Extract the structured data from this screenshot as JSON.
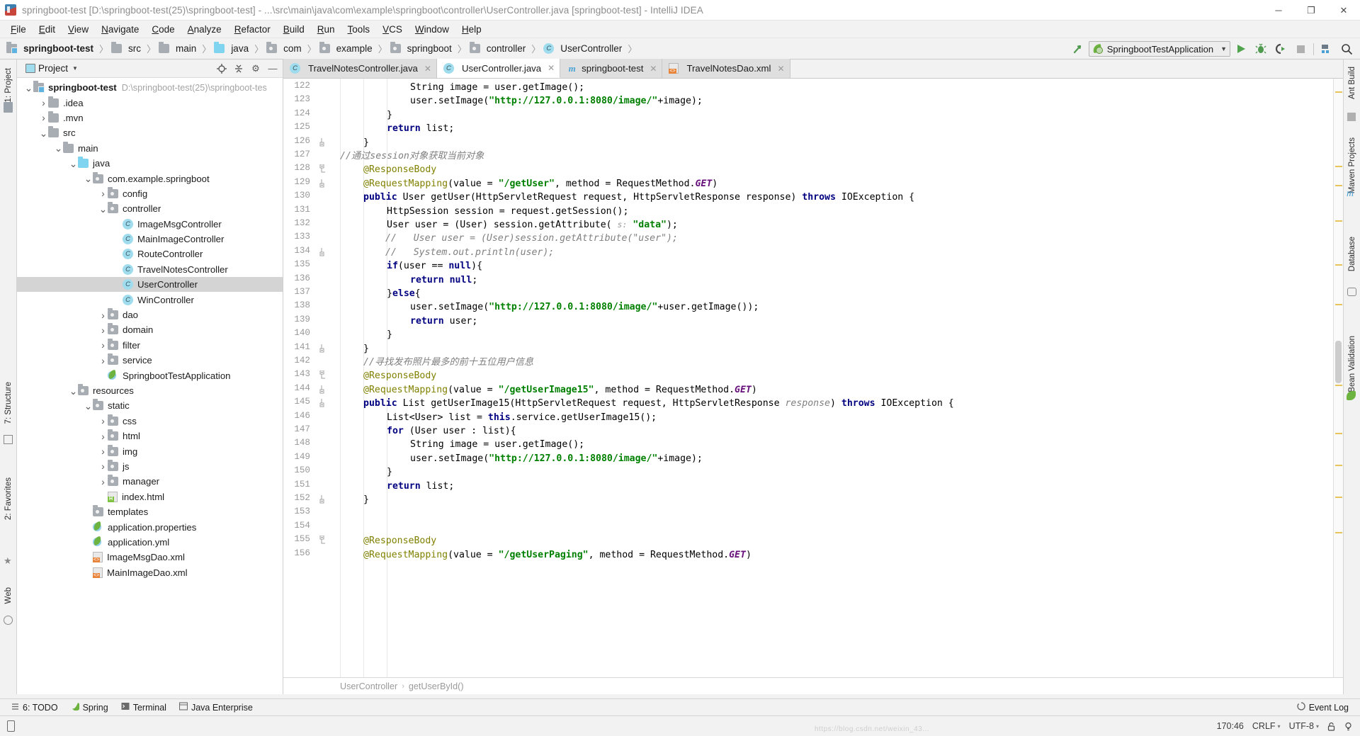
{
  "window": {
    "title": "springboot-test [D:\\springboot-test(25)\\springboot-test] - ...\\src\\main\\java\\com\\example\\springboot\\controller\\UserController.java [springboot-test] - IntelliJ IDEA",
    "minimize": "─",
    "maximize": "❐",
    "close": "✕"
  },
  "menu": [
    "File",
    "Edit",
    "View",
    "Navigate",
    "Code",
    "Analyze",
    "Refactor",
    "Build",
    "Run",
    "Tools",
    "VCS",
    "Window",
    "Help"
  ],
  "breadcrumbs": [
    {
      "label": "springboot-test",
      "icon": "module-icon"
    },
    {
      "label": "src",
      "icon": "folder-icon"
    },
    {
      "label": "main",
      "icon": "folder-icon"
    },
    {
      "label": "java",
      "icon": "source-folder-icon"
    },
    {
      "label": "com",
      "icon": "package-icon"
    },
    {
      "label": "example",
      "icon": "package-icon"
    },
    {
      "label": "springboot",
      "icon": "package-icon"
    },
    {
      "label": "controller",
      "icon": "package-icon"
    },
    {
      "label": "UserController",
      "icon": "class-icon"
    }
  ],
  "toolbar": {
    "hammer_icon": "build-icon",
    "run_config": "SpringbootTestApplication",
    "run_icon": "run-icon",
    "debug_icon": "debug-icon",
    "run_coverage_icon": "run-with-coverage-icon",
    "stop_icon": "stop-icon",
    "project_structure_icon": "project-structure-icon",
    "search_icon": "search-everywhere-icon"
  },
  "project_panel": {
    "title": "Project",
    "locate_icon": "locate-file-icon",
    "collapse_icon": "collapse-all-icon",
    "settings_icon": "gear-icon",
    "hide_icon": "hide-icon",
    "tree": [
      {
        "label": "springboot-test",
        "path": "D:\\springboot-test(25)\\springboot-tes",
        "depth": 0,
        "arrow": "down",
        "icon": "module-icon",
        "bold": true
      },
      {
        "label": ".idea",
        "depth": 1,
        "arrow": "right",
        "icon": "folder-icon"
      },
      {
        "label": ".mvn",
        "depth": 1,
        "arrow": "right",
        "icon": "folder-icon"
      },
      {
        "label": "src",
        "depth": 1,
        "arrow": "down",
        "icon": "folder-icon"
      },
      {
        "label": "main",
        "depth": 2,
        "arrow": "down",
        "icon": "folder-icon"
      },
      {
        "label": "java",
        "depth": 3,
        "arrow": "down",
        "icon": "source-folder-icon"
      },
      {
        "label": "com.example.springboot",
        "depth": 4,
        "arrow": "down",
        "icon": "package-icon"
      },
      {
        "label": "config",
        "depth": 5,
        "arrow": "right",
        "icon": "package-icon"
      },
      {
        "label": "controller",
        "depth": 5,
        "arrow": "down",
        "icon": "package-icon"
      },
      {
        "label": "ImageMsgController",
        "depth": 6,
        "arrow": "none",
        "icon": "class-icon"
      },
      {
        "label": "MainImageController",
        "depth": 6,
        "arrow": "none",
        "icon": "class-icon"
      },
      {
        "label": "RouteController",
        "depth": 6,
        "arrow": "none",
        "icon": "class-icon"
      },
      {
        "label": "TravelNotesController",
        "depth": 6,
        "arrow": "none",
        "icon": "class-icon"
      },
      {
        "label": "UserController",
        "depth": 6,
        "arrow": "none",
        "icon": "class-icon",
        "selected": true
      },
      {
        "label": "WinController",
        "depth": 6,
        "arrow": "none",
        "icon": "class-icon"
      },
      {
        "label": "dao",
        "depth": 5,
        "arrow": "right",
        "icon": "package-icon"
      },
      {
        "label": "domain",
        "depth": 5,
        "arrow": "right",
        "icon": "package-icon"
      },
      {
        "label": "filter",
        "depth": 5,
        "arrow": "right",
        "icon": "package-icon"
      },
      {
        "label": "service",
        "depth": 5,
        "arrow": "right",
        "icon": "package-icon"
      },
      {
        "label": "SpringbootTestApplication",
        "depth": 5,
        "arrow": "none",
        "icon": "spring-class-icon"
      },
      {
        "label": "resources",
        "depth": 3,
        "arrow": "down",
        "icon": "resource-folder-icon"
      },
      {
        "label": "static",
        "depth": 4,
        "arrow": "down",
        "icon": "package-icon"
      },
      {
        "label": "css",
        "depth": 5,
        "arrow": "right",
        "icon": "package-icon"
      },
      {
        "label": "html",
        "depth": 5,
        "arrow": "right",
        "icon": "package-icon"
      },
      {
        "label": "img",
        "depth": 5,
        "arrow": "right",
        "icon": "package-icon"
      },
      {
        "label": "js",
        "depth": 5,
        "arrow": "right",
        "icon": "package-icon"
      },
      {
        "label": "manager",
        "depth": 5,
        "arrow": "right",
        "icon": "package-icon"
      },
      {
        "label": "index.html",
        "depth": 5,
        "arrow": "none",
        "icon": "html-file-icon"
      },
      {
        "label": "templates",
        "depth": 4,
        "arrow": "none",
        "icon": "package-icon"
      },
      {
        "label": "application.properties",
        "depth": 4,
        "arrow": "none",
        "icon": "spring-file-icon"
      },
      {
        "label": "application.yml",
        "depth": 4,
        "arrow": "none",
        "icon": "spring-file-icon"
      },
      {
        "label": "ImageMsgDao.xml",
        "depth": 4,
        "arrow": "none",
        "icon": "xml-file-icon"
      },
      {
        "label": "MainImageDao.xml",
        "depth": 4,
        "arrow": "none",
        "icon": "xml-file-icon"
      }
    ]
  },
  "left_rail": [
    {
      "label": "1: Project",
      "icon": "project-tool-icon"
    },
    {
      "label": "7: Structure",
      "icon": "structure-tool-icon"
    },
    {
      "label": "2: Favorites",
      "icon": "favorites-tool-icon"
    },
    {
      "label": "Web",
      "icon": "web-tool-icon"
    }
  ],
  "right_rail": [
    {
      "label": "Ant Build",
      "icon": "ant-icon"
    },
    {
      "label": "Maven Projects",
      "icon": "maven-icon"
    },
    {
      "label": "Database",
      "icon": "database-icon"
    },
    {
      "label": "Bean Validation",
      "icon": "bean-validation-icon"
    }
  ],
  "tabs": [
    {
      "label": "TravelNotesController.java",
      "icon": "class-icon",
      "active": false,
      "close": "✕"
    },
    {
      "label": "UserController.java",
      "icon": "class-icon",
      "active": true,
      "close": "✕"
    },
    {
      "label": "springboot-test",
      "icon": "maven-icon",
      "active": false,
      "close": "✕"
    },
    {
      "label": "TravelNotesDao.xml",
      "icon": "xml-file-icon",
      "active": false,
      "close": "✕"
    }
  ],
  "editor": {
    "first_line": 122,
    "lines": [
      {
        "n": 122,
        "indent": 3,
        "html": "String image = user.getImage();"
      },
      {
        "n": 123,
        "indent": 3,
        "html": "user.setImage(<span class=\"s\">\"http://127.0.0.1:8080/image/\"</span>+image);"
      },
      {
        "n": 124,
        "indent": 2,
        "html": "}"
      },
      {
        "n": 125,
        "indent": 2,
        "html": "<span class=\"k\">return</span> list;"
      },
      {
        "n": 126,
        "indent": 1,
        "html": "}",
        "fold": "collapse"
      },
      {
        "n": 127,
        "indent": 0,
        "html": "<span class=\"c\">//通过session对象获取当前对象</span>"
      },
      {
        "n": 128,
        "indent": 1,
        "html": "<span class=\"a\">@ResponseBody</span>",
        "fold": "open"
      },
      {
        "n": 129,
        "indent": 1,
        "html": "<span class=\"a\">@RequestMapping</span>(value = <span class=\"s\">\"/getUser\"</span>, method = RequestMethod.<span class=\"f\">GET</span>)",
        "fold": "collapse"
      },
      {
        "n": 130,
        "indent": 1,
        "html": "<span class=\"k\">public</span> User getUser(HttpServletRequest request, HttpServletResponse response) <span class=\"k\">throws</span> IOException {"
      },
      {
        "n": 131,
        "indent": 2,
        "html": "HttpSession session = request.getSession();"
      },
      {
        "n": 132,
        "indent": 2,
        "html": "User user = (User) session.getAttribute( <span class=\"hint\">s:</span> <span class=\"s\">\"data\"</span>);"
      },
      {
        "n": 133,
        "indent": 2,
        "html": "<span class=\"c\">User user = (User)session.getAttribute(\"user\");</span>",
        "prefix": "//"
      },
      {
        "n": 134,
        "indent": 2,
        "html": "<span class=\"c\">System.out.println(user);</span>",
        "prefix": "//",
        "fold": "collapse"
      },
      {
        "n": 135,
        "indent": 2,
        "html": "<span class=\"k\">if</span>(user == <span class=\"k\">null</span>){"
      },
      {
        "n": 136,
        "indent": 3,
        "html": "<span class=\"k\">return null</span>;"
      },
      {
        "n": 137,
        "indent": 2,
        "html": "}<span class=\"k\">else</span>{"
      },
      {
        "n": 138,
        "indent": 3,
        "html": "user.setImage(<span class=\"s\">\"http://127.0.0.1:8080/image/\"</span>+user.getImage());"
      },
      {
        "n": 139,
        "indent": 3,
        "html": "<span class=\"k\">return</span> user;"
      },
      {
        "n": 140,
        "indent": 2,
        "html": "}"
      },
      {
        "n": 141,
        "indent": 1,
        "html": "}",
        "fold": "collapse"
      },
      {
        "n": 142,
        "indent": 1,
        "html": "<span class=\"c\">//寻找发布照片最多的前十五位用户信息</span>"
      },
      {
        "n": 143,
        "indent": 1,
        "html": "<span class=\"a\">@ResponseBody</span>",
        "fold": "open"
      },
      {
        "n": 144,
        "indent": 1,
        "html": "<span class=\"a\">@RequestMapping</span>(value = <span class=\"s\">\"/getUserImage15\"</span>, method = RequestMethod.<span class=\"f\">GET</span>)",
        "fold": "collapse"
      },
      {
        "n": 145,
        "indent": 1,
        "html": "<span class=\"k\">public</span> List getUserImage15(HttpServletRequest request, HttpServletResponse <span class=\"p\">response</span>) <span class=\"k\">throws</span> IOException {",
        "fold": "collapse"
      },
      {
        "n": 146,
        "indent": 2,
        "html": "List&lt;User&gt; list = <span class=\"k\">this</span>.service.getUserImage15();"
      },
      {
        "n": 147,
        "indent": 2,
        "html": "<span class=\"k\">for</span> (User user : list){"
      },
      {
        "n": 148,
        "indent": 3,
        "html": "String image = user.getImage();"
      },
      {
        "n": 149,
        "indent": 3,
        "html": "user.setImage(<span class=\"s\">\"http://127.0.0.1:8080/image/\"</span>+image);"
      },
      {
        "n": 150,
        "indent": 2,
        "html": "}"
      },
      {
        "n": 151,
        "indent": 2,
        "html": "<span class=\"k\">return</span> list;"
      },
      {
        "n": 152,
        "indent": 1,
        "html": "}",
        "fold": "collapse"
      },
      {
        "n": 153,
        "indent": 0,
        "html": ""
      },
      {
        "n": 154,
        "indent": 0,
        "html": ""
      },
      {
        "n": 155,
        "indent": 1,
        "html": "<span class=\"a\">@ResponseBody</span>",
        "fold": "open"
      },
      {
        "n": 156,
        "indent": 1,
        "html": "<span class=\"a\">@RequestMapping</span>(value = <span class=\"s\">\"/getUserPaging\"</span>, method = RequestMethod.<span class=\"f\">GET</span>)"
      }
    ]
  },
  "editor_breadcrumb": {
    "class": "UserController",
    "separator": "›",
    "method": "getUserById()"
  },
  "bottom_tools": [
    {
      "label": "6: TODO",
      "icon": "todo-icon"
    },
    {
      "label": "Spring",
      "icon": "spring-icon"
    },
    {
      "label": "Terminal",
      "icon": "terminal-icon"
    },
    {
      "label": "Java Enterprise",
      "icon": "java-enterprise-icon"
    }
  ],
  "event_log": {
    "label": "Event Log",
    "icon": "event-log-icon"
  },
  "status_bar": {
    "caret": "170:46",
    "line_sep": "CRLF",
    "encoding": "UTF-8",
    "lock_icon": "lock-icon",
    "inspection_icon": "inspection-icon",
    "watermark": "https://blog.csdn.net/weixin_43...",
    "tray_icon": "tray-icon"
  },
  "colors": {
    "accent_blue": "#9fdcee",
    "spring_green": "#6db33f",
    "string_green": "#008000",
    "keyword_navy": "#000080",
    "comment_grey": "#808080",
    "annotation_olive": "#808000",
    "selection_grey": "#d4d4d4"
  }
}
